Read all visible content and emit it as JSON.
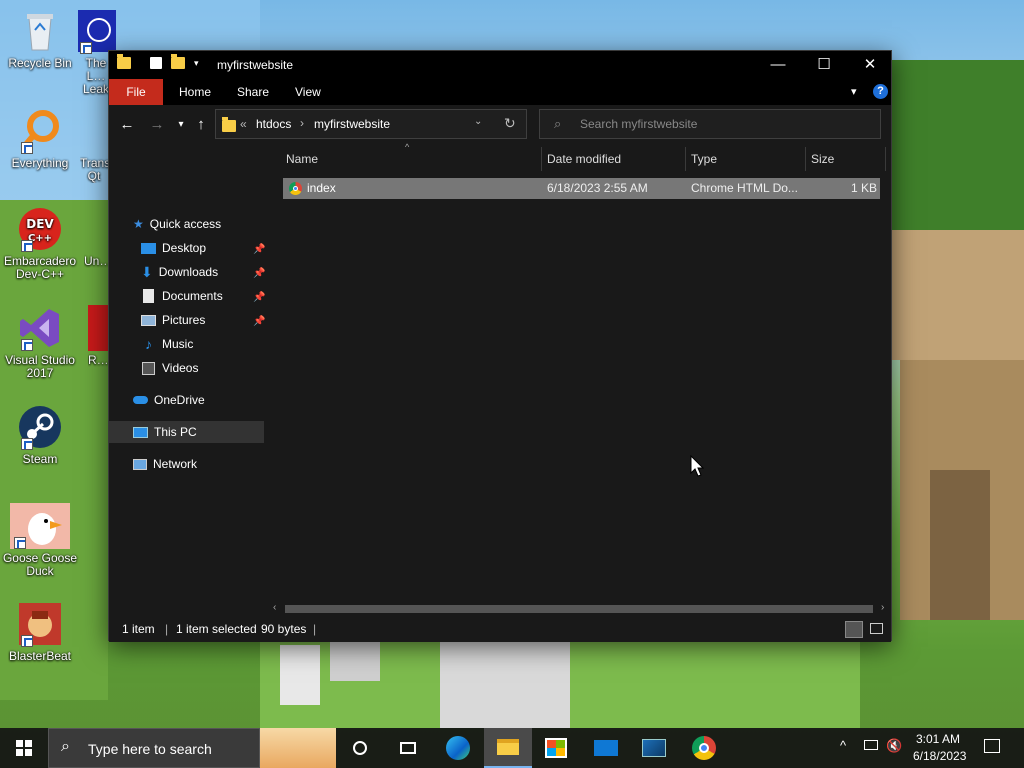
{
  "desktop": {
    "icons": [
      {
        "label": "Recycle Bin",
        "icon": "recycle-bin-icon"
      },
      {
        "label": "The L… Leak",
        "icon": "app-icon"
      },
      {
        "label": "Everything",
        "icon": "everything-icon"
      },
      {
        "label": "Trans… Qt",
        "icon": "app-icon"
      },
      {
        "label": "Embarcadero Dev-C++",
        "icon": "devcpp-icon"
      },
      {
        "label": "Un…",
        "icon": "app-icon"
      },
      {
        "label": "Visual Studio 2017",
        "icon": "visual-studio-icon"
      },
      {
        "label": "R…",
        "icon": "app-icon"
      },
      {
        "label": "Steam",
        "icon": "steam-icon"
      },
      {
        "label": "Goose Goose Duck",
        "icon": "goose-icon"
      },
      {
        "label": "BlasterBeat",
        "icon": "blasterbeat-icon"
      }
    ]
  },
  "window": {
    "title": "myfirstwebsite",
    "controls": {
      "minimize": "—",
      "maximize": "☐",
      "close": "✕"
    },
    "ribbon_tabs": [
      "File",
      "Home",
      "Share",
      "View"
    ],
    "address": {
      "prefix": "«",
      "crumbs": [
        "htdocs",
        "myfirstwebsite"
      ],
      "sep": "›"
    },
    "search_placeholder": "Search myfirstwebsite",
    "nav": {
      "quick_access": "Quick access",
      "items": [
        {
          "label": "Desktop",
          "pinned": true
        },
        {
          "label": "Downloads",
          "pinned": true
        },
        {
          "label": "Documents",
          "pinned": true
        },
        {
          "label": "Pictures",
          "pinned": true
        },
        {
          "label": "Music",
          "pinned": false
        },
        {
          "label": "Videos",
          "pinned": false
        }
      ],
      "onedrive": "OneDrive",
      "this_pc": "This PC",
      "network": "Network"
    },
    "columns": [
      "Name",
      "Date modified",
      "Type",
      "Size"
    ],
    "files": [
      {
        "name": "index",
        "date": "6/18/2023 2:55 AM",
        "type": "Chrome HTML Do...",
        "size": "1 KB"
      }
    ],
    "status": {
      "count": "1 item",
      "selected": "1 item selected",
      "size": "90 bytes"
    }
  },
  "taskbar": {
    "search_placeholder": "Type here to search",
    "time": "3:01 AM",
    "date": "6/18/2023"
  },
  "colors": {
    "file_tab": "#c42b1c",
    "selection": "#777777",
    "folder": "#f8cd47",
    "accent": "#0078d7"
  }
}
